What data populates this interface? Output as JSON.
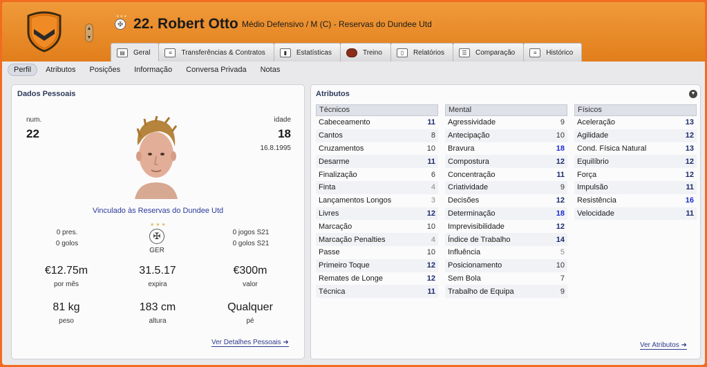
{
  "header": {
    "player_name": "22. Robert Otto",
    "player_desc": "Médio Defensivo / M (C) - Reservas do Dundee Utd"
  },
  "tabs": [
    {
      "label": "Geral",
      "icon": "card-icon"
    },
    {
      "label": "Transferências & Contratos",
      "icon": "document-icon"
    },
    {
      "label": "Estatísticas",
      "icon": "bar-chart-icon"
    },
    {
      "label": "Treino",
      "icon": "ball-icon"
    },
    {
      "label": "Relatórios",
      "icon": "report-icon"
    },
    {
      "label": "Comparação",
      "icon": "compare-icon"
    },
    {
      "label": "Histórico",
      "icon": "history-icon"
    }
  ],
  "subnav": [
    "Perfil",
    "Atributos",
    "Posições",
    "Informação",
    "Conversa Privada",
    "Notas"
  ],
  "personal": {
    "title": "Dados Pessoais",
    "num_label": "num.",
    "num": "22",
    "age_label": "idade",
    "age": "18",
    "dob": "16.8.1995",
    "club_link": "Vinculado às Reservas do Dundee Utd",
    "apps": "0 pres.",
    "goals": "0 golos",
    "nation": "GER",
    "u21_apps": "0 jogos S21",
    "u21_goals": "0 golos S21",
    "wage": "€12.75m",
    "wage_label": "por mês",
    "expiry": "31.5.17",
    "expiry_label": "expira",
    "value": "€300m",
    "value_label": "valor",
    "weight": "81 kg",
    "weight_label": "peso",
    "height": "183 cm",
    "height_label": "altura",
    "foot": "Qualquer",
    "foot_label": "pé",
    "details_link": "Ver Detalhes Pessoais ➜"
  },
  "attributes": {
    "title": "Atributos",
    "link": "Ver Atributos ➜",
    "technical": {
      "header": "Técnicos",
      "rows": [
        {
          "name": "Cabeceamento",
          "value": "11"
        },
        {
          "name": "Cantos",
          "value": "8"
        },
        {
          "name": "Cruzamentos",
          "value": "10"
        },
        {
          "name": "Desarme",
          "value": "11"
        },
        {
          "name": "Finalização",
          "value": "6"
        },
        {
          "name": "Finta",
          "value": "4"
        },
        {
          "name": "Lançamentos Longos",
          "value": "3"
        },
        {
          "name": "Livres",
          "value": "12"
        },
        {
          "name": "Marcação",
          "value": "10"
        },
        {
          "name": "Marcação Penalties",
          "value": "4"
        },
        {
          "name": "Passe",
          "value": "10"
        },
        {
          "name": "Primeiro Toque",
          "value": "12"
        },
        {
          "name": "Remates de Longe",
          "value": "12"
        },
        {
          "name": "Técnica",
          "value": "11"
        }
      ]
    },
    "mental": {
      "header": "Mental",
      "rows": [
        {
          "name": "Agressividade",
          "value": "9"
        },
        {
          "name": "Antecipação",
          "value": "10"
        },
        {
          "name": "Bravura",
          "value": "18"
        },
        {
          "name": "Compostura",
          "value": "12"
        },
        {
          "name": "Concentração",
          "value": "11"
        },
        {
          "name": "Criatividade",
          "value": "9"
        },
        {
          "name": "Decisões",
          "value": "12"
        },
        {
          "name": "Determinação",
          "value": "18"
        },
        {
          "name": "Imprevisibilidade",
          "value": "12"
        },
        {
          "name": "Índice de Trabalho",
          "value": "14"
        },
        {
          "name": "Influência",
          "value": "5"
        },
        {
          "name": "Posicionamento",
          "value": "10"
        },
        {
          "name": "Sem Bola",
          "value": "7"
        },
        {
          "name": "Trabalho de Equipa",
          "value": "9"
        }
      ]
    },
    "physical": {
      "header": "Físicos",
      "rows": [
        {
          "name": "Aceleração",
          "value": "13"
        },
        {
          "name": "Agilidade",
          "value": "12"
        },
        {
          "name": "Cond. Física Natural",
          "value": "13"
        },
        {
          "name": "Equilíbrio",
          "value": "12"
        },
        {
          "name": "Força",
          "value": "12"
        },
        {
          "name": "Impulsão",
          "value": "11"
        },
        {
          "name": "Resistência",
          "value": "16"
        },
        {
          "name": "Velocidade",
          "value": "11"
        }
      ]
    }
  }
}
